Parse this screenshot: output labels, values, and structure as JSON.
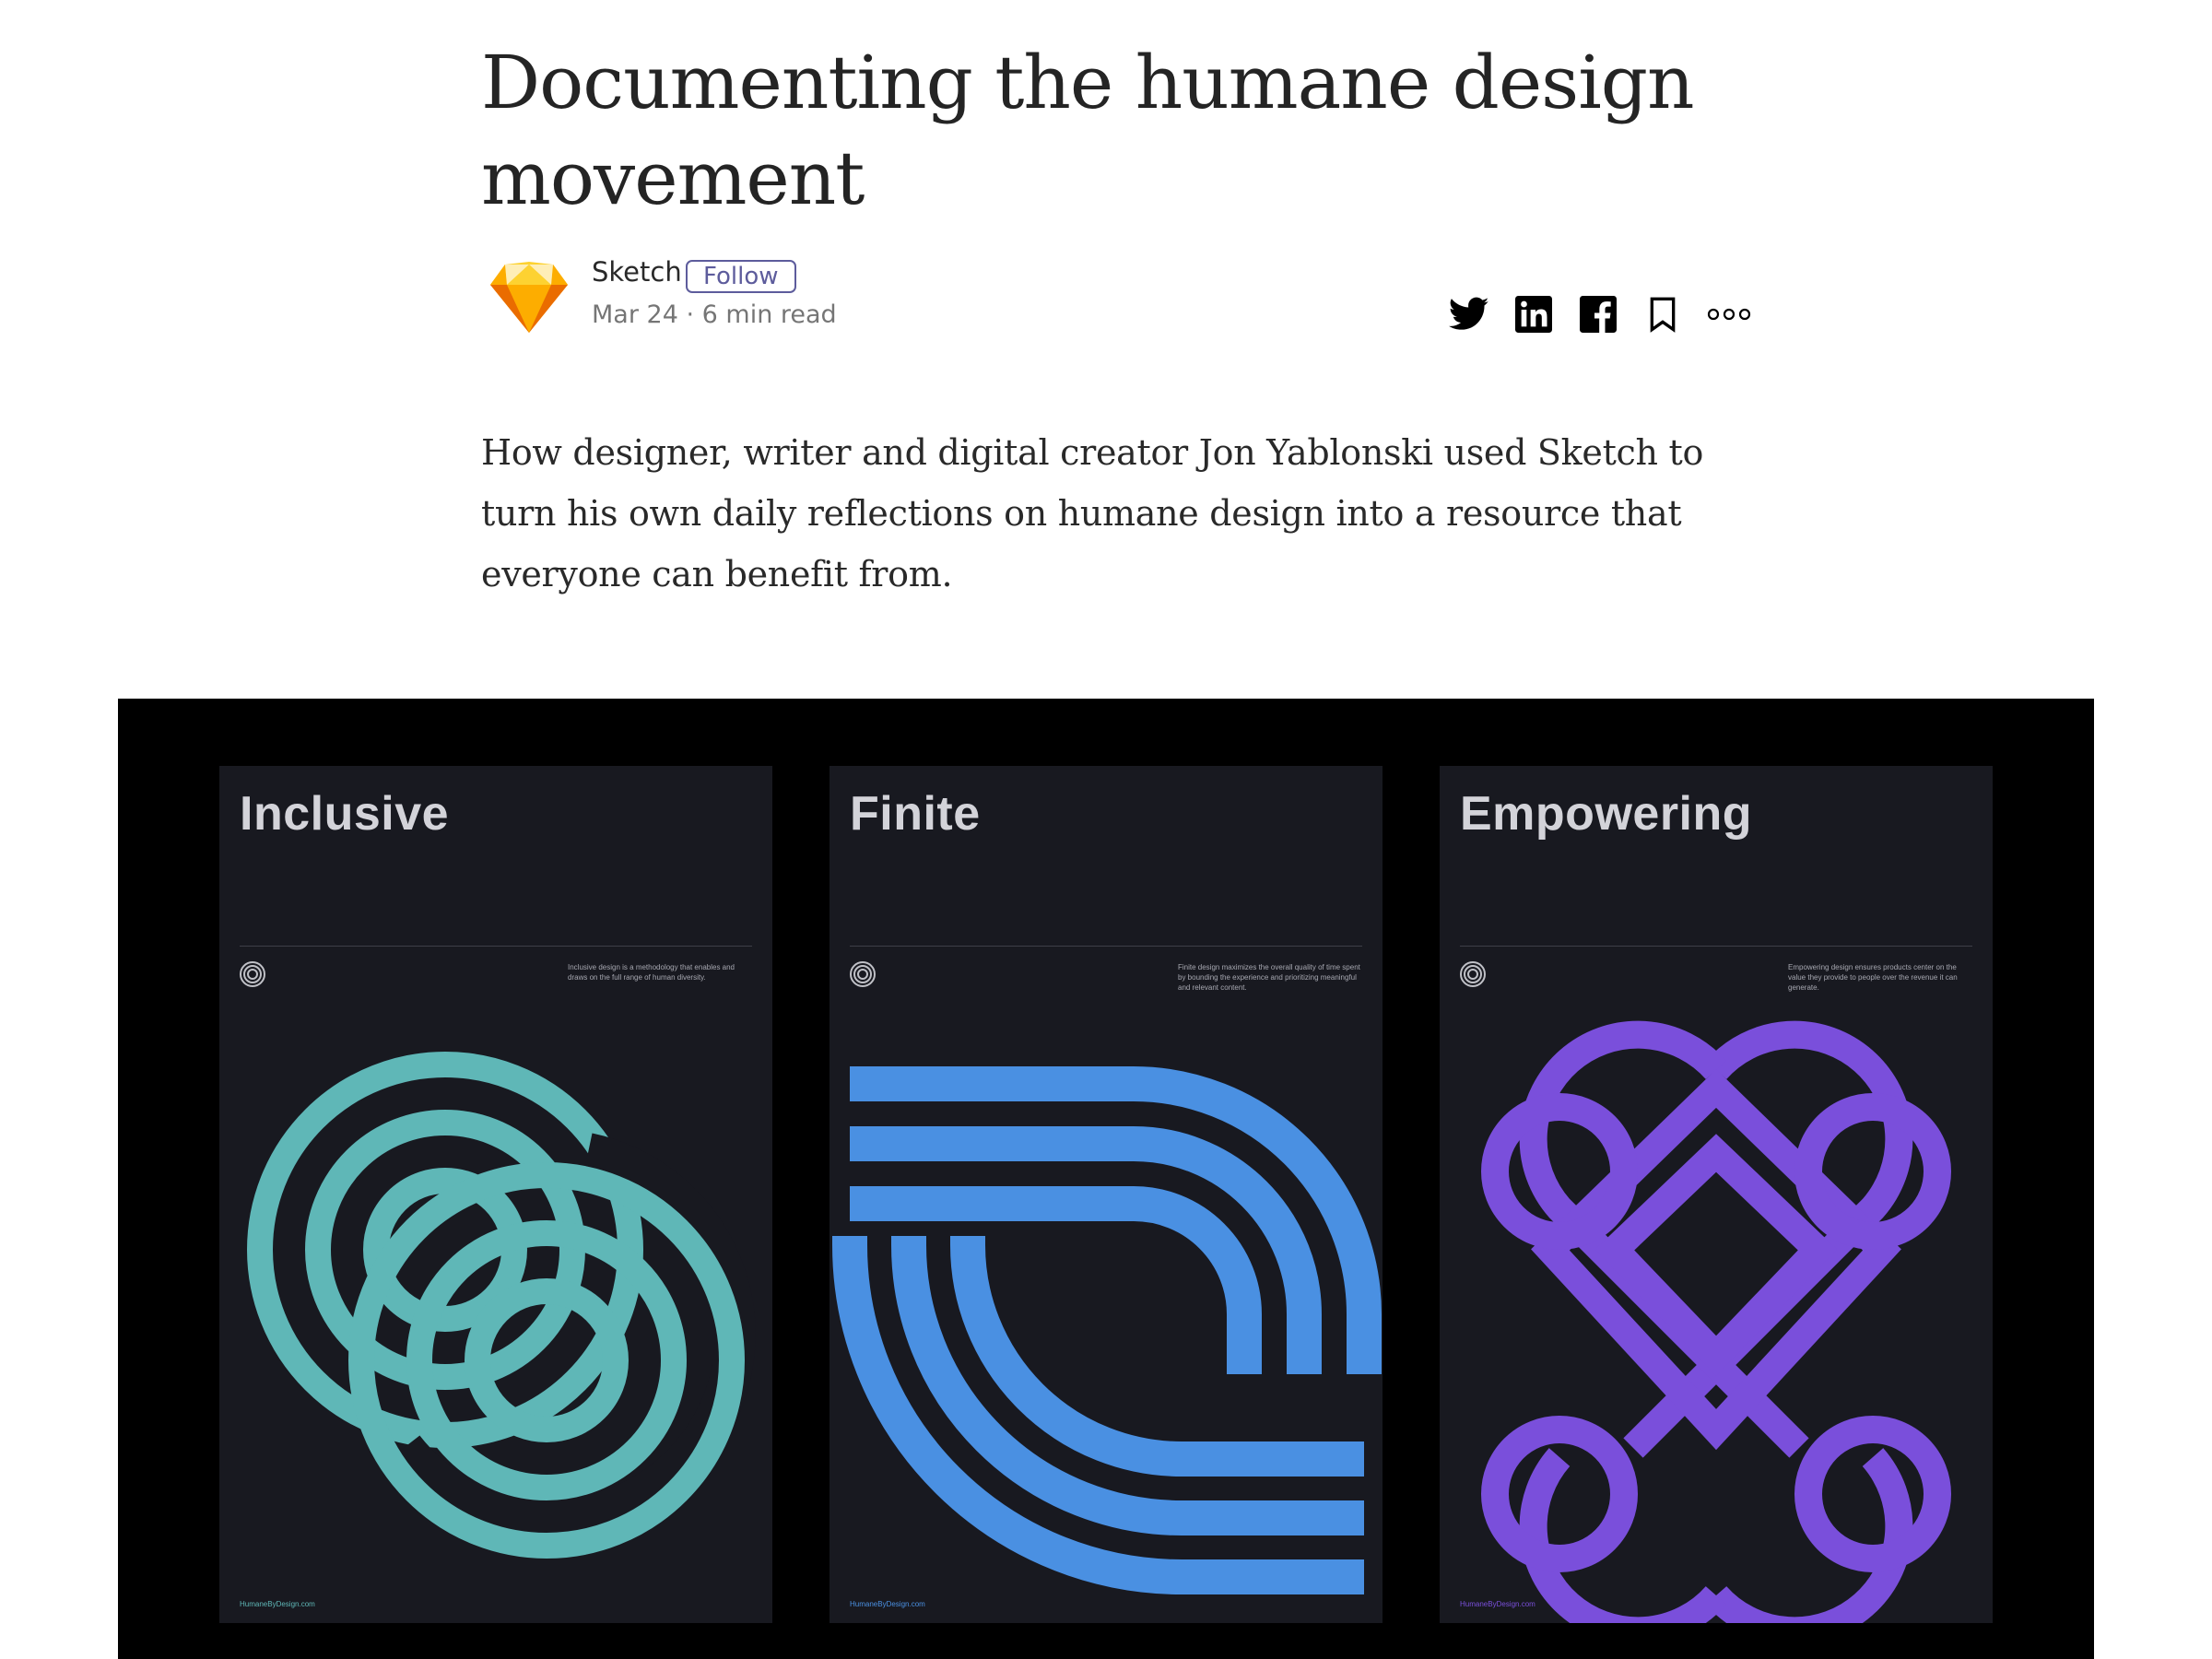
{
  "article": {
    "title": "Documenting the humane design movement",
    "lede": "How designer, writer and digital creator Jon Yablonski used Sketch to turn his own daily reflections on humane design into a resource that everyone can benefit from."
  },
  "byline": {
    "author": "Sketch",
    "follow_label": "Follow",
    "meta": "Mar 24 · 6 min read",
    "avatar_icon": "sketch-diamond-logo",
    "actions": [
      {
        "name": "twitter-icon"
      },
      {
        "name": "linkedin-icon"
      },
      {
        "name": "facebook-icon"
      },
      {
        "name": "bookmark-icon"
      },
      {
        "name": "more-options-icon"
      }
    ]
  },
  "figure": {
    "posters": [
      {
        "title": "Inclusive",
        "description": "Inclusive design is a methodology that enables and draws on the full range of human diversity.",
        "url": "HumaneByDesign.com",
        "color": "#5fb7b7"
      },
      {
        "title": "Finite",
        "description": "Finite design maximizes the overall quality of time spent by bounding the experience and prioritizing meaningful and relevant content.",
        "url": "HumaneByDesign.com",
        "color": "#4a90e2"
      },
      {
        "title": "Empowering",
        "description": "Empowering design ensures products center on the value they provide to people over the revenue it can generate.",
        "url": "HumaneByDesign.com",
        "color": "#7a4fdb"
      }
    ]
  },
  "colors": {
    "follow": "#5d5c9c",
    "poster_bg": "#181920",
    "figure_bg": "#000000"
  }
}
